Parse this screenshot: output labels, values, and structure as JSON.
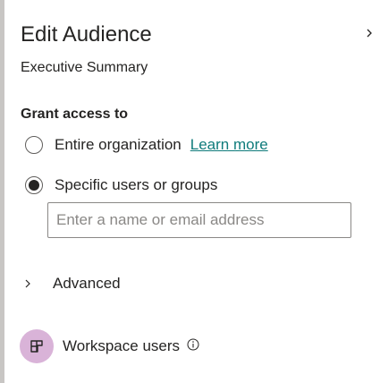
{
  "panel": {
    "title": "Edit Audience",
    "subtitle": "Executive Summary",
    "collapse_icon": "chevron-right-icon"
  },
  "grant_access": {
    "label": "Grant access to",
    "options": [
      {
        "label": "Entire organization",
        "selected": false,
        "link": "Learn more"
      },
      {
        "label": "Specific users or groups",
        "selected": true
      }
    ],
    "input": {
      "placeholder": "Enter a name or email address",
      "value": ""
    }
  },
  "advanced": {
    "label": "Advanced",
    "expanded": false,
    "icon": "chevron-right-icon"
  },
  "workspace": {
    "label": "Workspace users",
    "avatar_icon": "workspace-icon",
    "info_icon": "info-icon",
    "avatar_color": "#d9b3d8"
  },
  "colors": {
    "link": "#0f7b7b",
    "text": "#252423",
    "border": "#8a8886"
  }
}
